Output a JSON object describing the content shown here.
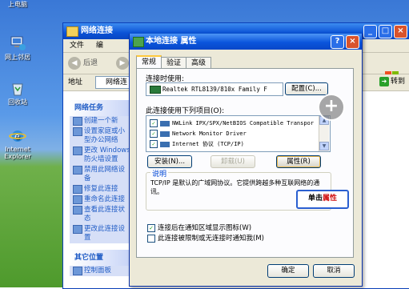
{
  "desktop": {
    "icons": [
      {
        "label": "网上邻居",
        "icon": "network-places-icon"
      },
      {
        "label": "回收站",
        "icon": "recycle-bin-icon"
      },
      {
        "label": "Internet Explorer",
        "icon": "ie-icon"
      }
    ],
    "top_partial_label": "上电脑"
  },
  "explorer": {
    "title": "网络连接",
    "menu": [
      "文件",
      "编"
    ],
    "back_label": "后退",
    "address_label": "地址",
    "address_value": "网络连",
    "go_label": "转到",
    "tasks_panel": {
      "title": "网络任务",
      "items": [
        "创建一个新",
        "设置家庭或小型办公网络",
        "更改 Windows 防火墙设置",
        "禁用此网络设备",
        "修复此连接",
        "重命名此连接",
        "查看此连接状态",
        "更改此连接设置"
      ]
    },
    "other_panel": {
      "title": "其它位置",
      "items": [
        "控制面板"
      ]
    }
  },
  "dialog": {
    "title": "本地连接 属性",
    "help_label": "?",
    "close_label": "×",
    "tabs": [
      "常规",
      "验证",
      "高级"
    ],
    "connect_using_label": "连接时使用:",
    "adapter_name": "Realtek RTL8139/810x Family F",
    "configure_label": "配置(C)...",
    "items_label": "此连接使用下列项目(O):",
    "items": [
      {
        "label": "NWLink IPX/SPX/NetBIOS Compatible Transpor",
        "checked": true
      },
      {
        "label": "Network Monitor Driver",
        "checked": true
      },
      {
        "label": "Internet 协议 (TCP/IP)",
        "checked": true
      }
    ],
    "install_label": "安装(N)...",
    "uninstall_label": "卸载(U)",
    "properties_label": "属性(R)",
    "description_title": "说明",
    "description_text": "TCP/IP 是默认的广域网协议。它提供跨越多种互联网络的通讯。",
    "show_icon_label": "连接后在通知区域显示图标(W)",
    "notify_label": "此连接被限制或无连接时通知我(M)",
    "ok_label": "确定",
    "cancel_label": "取消"
  },
  "callout": {
    "prefix": "单击",
    "highlight": "属性"
  },
  "colors": {
    "title_blue": "#0a55dc",
    "dialog_bg": "#ece9d8",
    "callout_red": "#d01010"
  }
}
